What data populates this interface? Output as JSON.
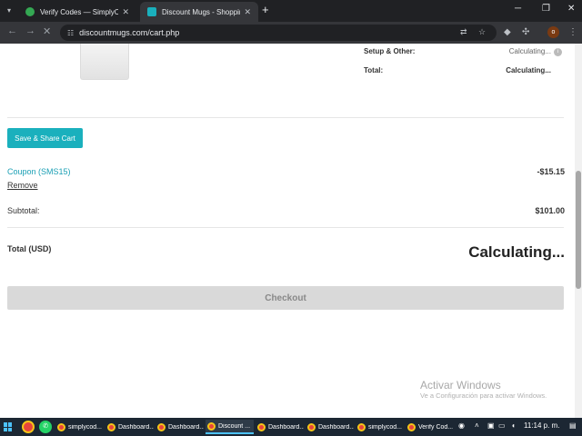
{
  "browser": {
    "tabs": [
      {
        "title": "Verify Codes — SimplyCodes",
        "active": false
      },
      {
        "title": "Discount Mugs - Shopping Cart",
        "active": true
      }
    ],
    "url": "discountmugs.com/cart.php"
  },
  "summary": {
    "setup_label": "Setup & Other:",
    "setup_value": "Calculating...",
    "total_label": "Total:",
    "total_value": "Calculating..."
  },
  "cart": {
    "share_button": "Save & Share Cart",
    "coupon_label": "Coupon (SMS15)",
    "coupon_value": "-$15.15",
    "remove_link": "Remove",
    "subtotal_label": "Subtotal:",
    "subtotal_value": "$101.00",
    "total_usd_label": "Total (USD)",
    "total_usd_value": "Calculating...",
    "checkout_button": "Checkout"
  },
  "watermark": {
    "line1": "Activar Windows",
    "line2": "Ve a Configuración para activar Windows."
  },
  "taskbar": {
    "items": [
      {
        "label": "simplycod...",
        "active": false
      },
      {
        "label": "Dashboard...",
        "active": false
      },
      {
        "label": "Dashboard...",
        "active": false
      },
      {
        "label": "Discount ...",
        "active": true
      },
      {
        "label": "Dashboard...",
        "active": false
      },
      {
        "label": "Dashboard...",
        "active": false
      },
      {
        "label": "simplycod...",
        "active": false
      },
      {
        "label": "Verify Cod...",
        "active": false
      }
    ],
    "clock": "11:14 p. m."
  },
  "colors": {
    "accent": "#1ab0bd",
    "coupon_link": "#1a9fb4",
    "checkout_disabled": "#d9d9d9"
  }
}
